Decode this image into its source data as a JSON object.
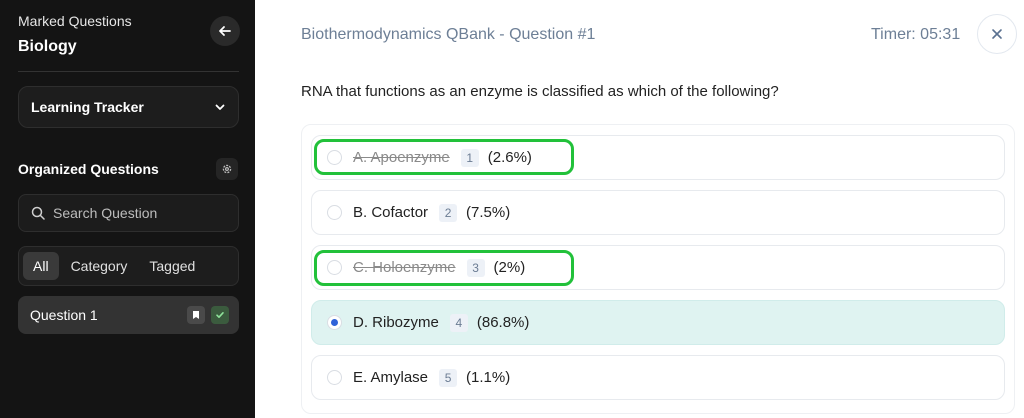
{
  "sidebar": {
    "subtitle": "Marked Questions",
    "title": "Biology",
    "learning_tracker": "Learning Tracker",
    "organized_label": "Organized Questions",
    "search_placeholder": "Search Question",
    "tabs": [
      {
        "label": "All",
        "active": true
      },
      {
        "label": "Category",
        "active": false
      },
      {
        "label": "Tagged",
        "active": false
      }
    ],
    "questions": [
      {
        "label": "Question 1",
        "bookmarked": true,
        "answered": true
      }
    ]
  },
  "main": {
    "title": "Biothermodynamics QBank - Question #1",
    "timer": "Timer: 05:31",
    "question": "RNA that functions as an enzyme is classified as which of the following?",
    "options": [
      {
        "text": "A. Apoenzyme",
        "count": "1",
        "percent": "(2.6%)",
        "struck": true,
        "selected": false,
        "highlighted": true
      },
      {
        "text": "B. Cofactor",
        "count": "2",
        "percent": "(7.5%)",
        "struck": false,
        "selected": false,
        "highlighted": false
      },
      {
        "text": "C. Holoenzyme",
        "count": "3",
        "percent": "(2%)",
        "struck": true,
        "selected": false,
        "highlighted": true
      },
      {
        "text": "D. Ribozyme",
        "count": "4",
        "percent": "(86.8%)",
        "struck": false,
        "selected": true,
        "highlighted": false
      },
      {
        "text": "E. Amylase",
        "count": "5",
        "percent": "(1.1%)",
        "struck": false,
        "selected": false,
        "highlighted": false
      }
    ]
  },
  "colors": {
    "sidebar_bg": "#141414",
    "selected_option_bg": "#dff3f1",
    "highlight": "#22c13a",
    "radio_selected": "#2f62d8",
    "title_text": "#6d7f96"
  }
}
